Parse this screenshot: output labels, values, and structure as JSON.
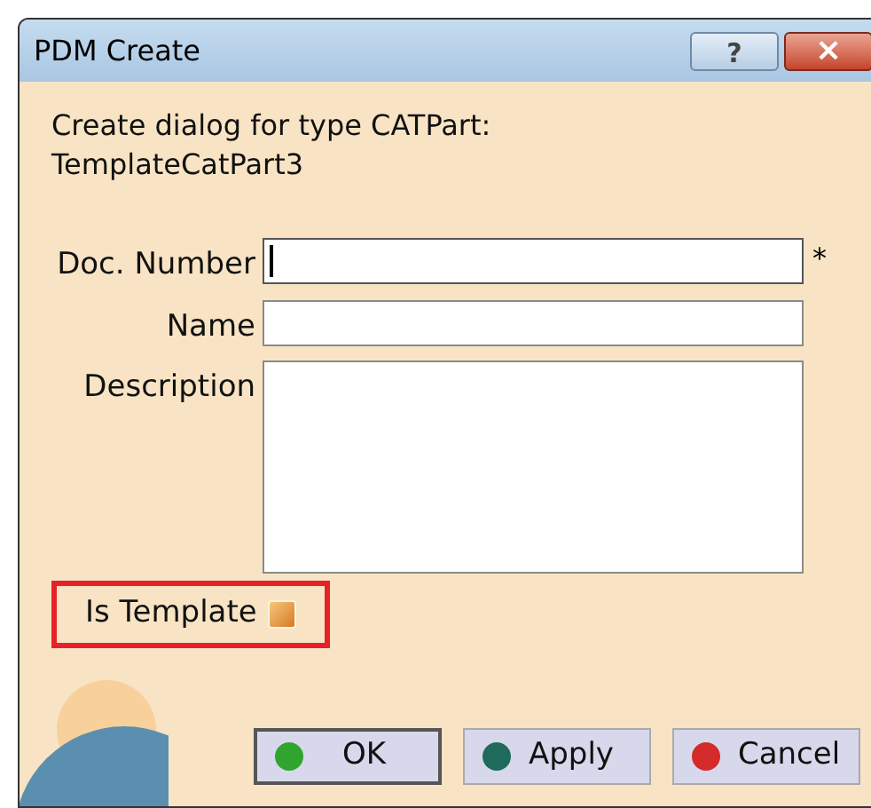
{
  "window": {
    "title": "PDM Create",
    "help_button": "?",
    "close_button": "×"
  },
  "message": [
    "Create dialog for type CATPart:",
    "TemplateCatPart3"
  ],
  "fields": [
    {
      "kind": "line",
      "label": "Doc. Number",
      "focused": true,
      "required_mark": "*"
    },
    {
      "kind": "line",
      "label": "Name",
      "focused": false
    },
    {
      "kind": "area",
      "label": "Description",
      "focused": false
    }
  ],
  "is_template": {
    "label": "Is Template",
    "checked": false,
    "highlighted": true
  },
  "buttons": [
    {
      "label": "OK",
      "color": "#2fa52f",
      "focused": true
    },
    {
      "label": "Apply",
      "color": "#1f6a5a",
      "focused": false
    },
    {
      "label": "Cancel",
      "color": "#d42a2a",
      "focused": false
    }
  ]
}
